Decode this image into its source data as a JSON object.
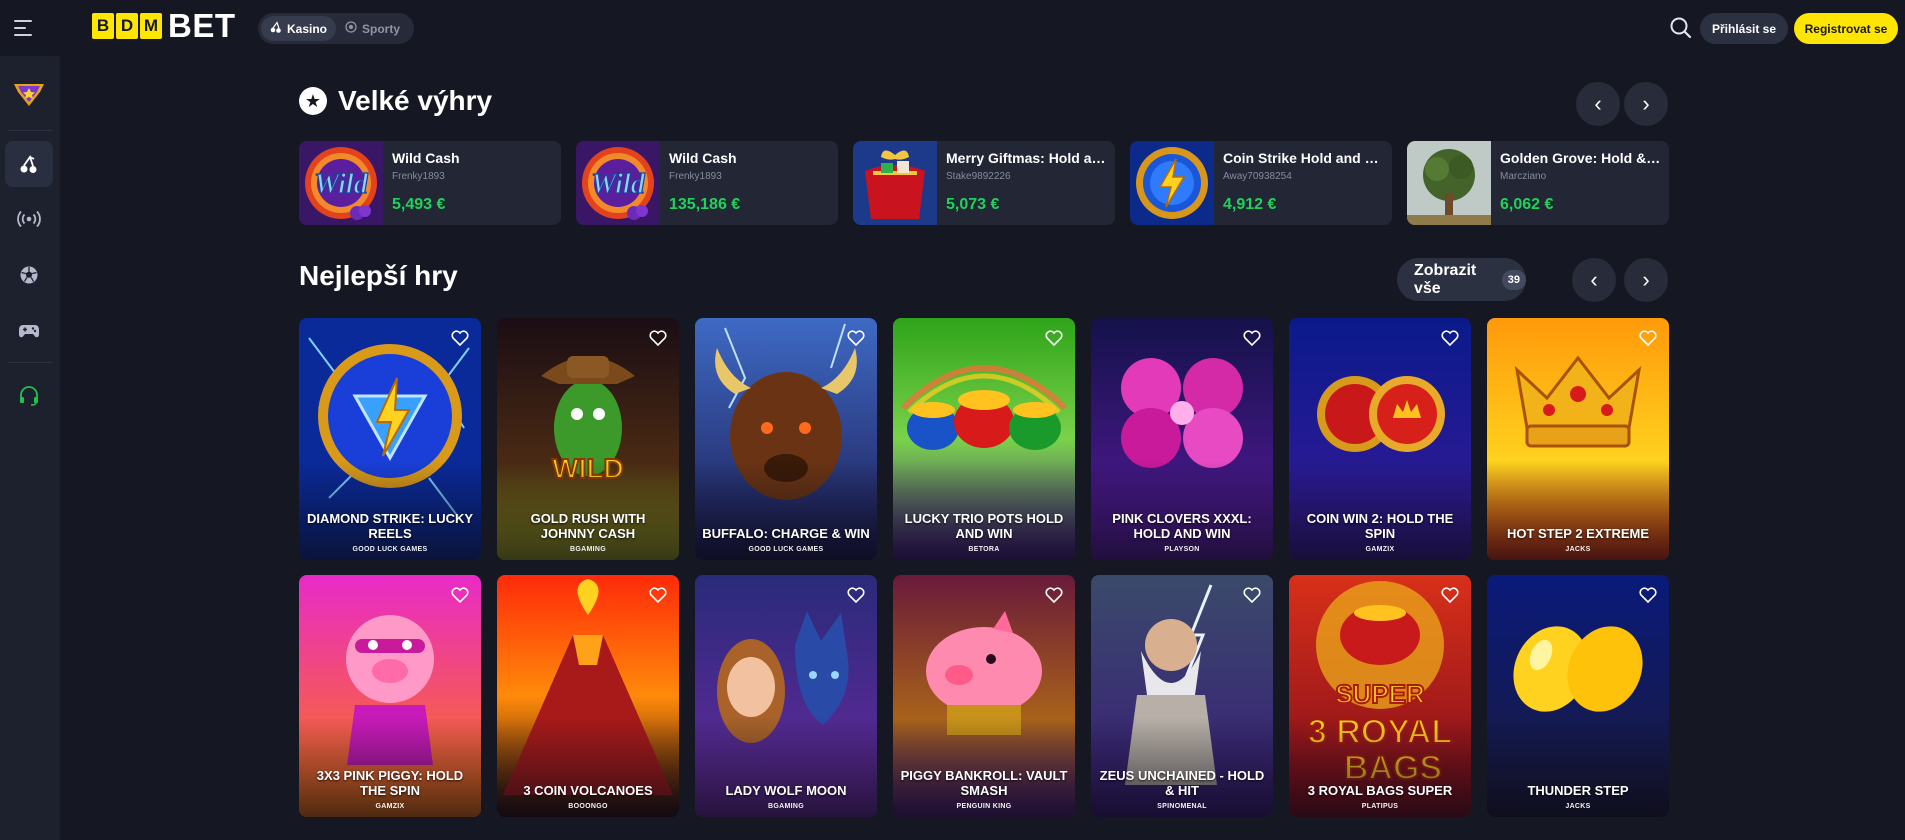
{
  "header": {
    "logo_letters": [
      "B",
      "D",
      "M"
    ],
    "logo_word": "BET",
    "tabs": [
      {
        "label": "Kasino",
        "active": true
      },
      {
        "label": "Sporty",
        "active": false
      }
    ],
    "login_label": "Přihlásit se",
    "register_label": "Registrovat se"
  },
  "sidebar": {
    "items": [
      "rank-icon",
      "casino-icon",
      "live-icon",
      "football-icon",
      "gamepad-icon",
      "support-icon"
    ]
  },
  "big_wins": {
    "title": "Velké výhry",
    "cards": [
      {
        "game": "Wild Cash",
        "user": "Frenky1893",
        "amount": "5,493 €"
      },
      {
        "game": "Wild Cash",
        "user": "Frenky1893",
        "amount": "135,186 €"
      },
      {
        "game": "Merry Giftmas: Hold and Win",
        "user": "Stake9892226",
        "amount": "5,073 €"
      },
      {
        "game": "Coin Strike Hold and Win",
        "user": "Away70938254",
        "amount": "4,912 €"
      },
      {
        "game": "Golden Grove: Hold & Win",
        "user": "Marcziano",
        "amount": "6,062 €"
      }
    ]
  },
  "top_games": {
    "title": "Nejlepší hry",
    "show_all_label": "Zobrazit vše",
    "count": "39",
    "games": [
      {
        "title": "Diamond Strike: Lucky Reels",
        "provider": "Good Luck Games"
      },
      {
        "title": "Gold Rush with Johnny Cash",
        "provider": "BGaming"
      },
      {
        "title": "Buffalo: Charge & Win",
        "provider": "Good Luck Games"
      },
      {
        "title": "Lucky Trio Pots Hold and Win",
        "provider": "Betora"
      },
      {
        "title": "Pink Clovers XXXL: Hold and Win",
        "provider": "Playson"
      },
      {
        "title": "Coin Win 2: Hold the Spin",
        "provider": "Gamzix"
      },
      {
        "title": "Hot Step 2 Extreme",
        "provider": "Jacks"
      },
      {
        "title": "3x3 Pink Piggy: Hold the Spin",
        "provider": "Gamzix"
      },
      {
        "title": "3 Coin Volcanoes",
        "provider": "Booongo"
      },
      {
        "title": "Lady Wolf Moon",
        "provider": "BGaming"
      },
      {
        "title": "Piggy Bankroll: Vault Smash",
        "provider": "Penguin King"
      },
      {
        "title": "Zeus Unchained - Hold & Hit",
        "provider": "Spinomenal"
      },
      {
        "title": "3 Royal Bags Super",
        "provider": "Platipus"
      },
      {
        "title": "Thunder Step",
        "provider": "Jacks"
      }
    ]
  },
  "colors": {
    "background": "#151823",
    "sidebar": "#1d212e",
    "accent_yellow": "#ffe600",
    "win_green": "#20d25a"
  }
}
